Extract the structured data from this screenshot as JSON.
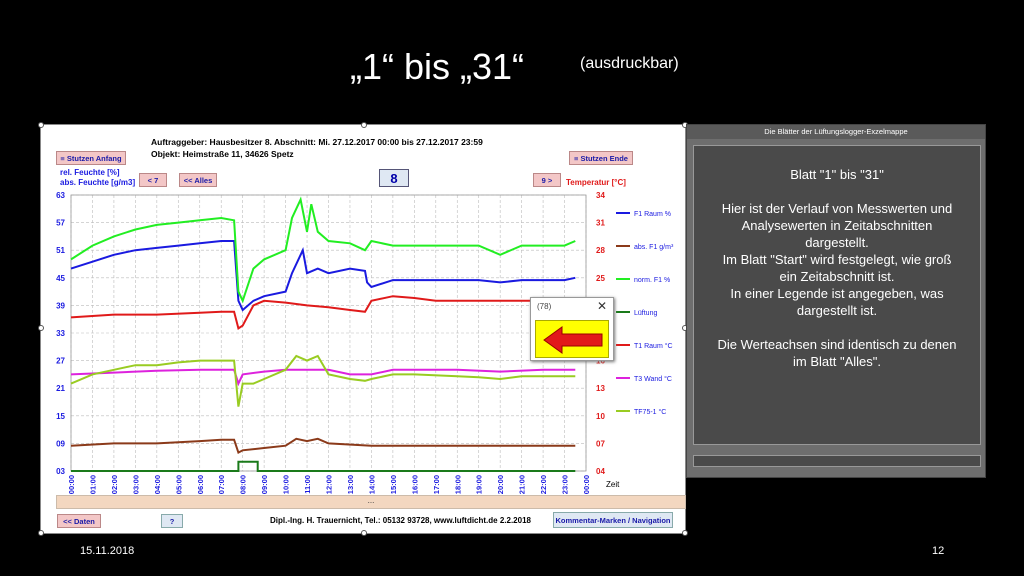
{
  "slide": {
    "title": "„1“ bis „31“",
    "subtitle": "(ausdruckbar)",
    "date": "15.11.2018",
    "page_number": "12"
  },
  "sheet": {
    "client_line": "Auftraggeber: Hausbesitzer     8. Abschnitt: Mi. 27.12.2017 00:00 bis 27.12.2017 23:59",
    "object_line": "Objekt: Heimstraße 11, 34626 Spetz",
    "btn_start": "≡ Stutzen Anfang",
    "btn_end": "≡ Stutzen Ende",
    "btn_prev": "< 7",
    "btn_all": "<< Alles",
    "btn_next": "9 >",
    "page_value": "8",
    "left_axis_label1": "rel. Feuchte [%]",
    "left_axis_label2": "abs. Feuchte [g/m3]",
    "right_axis_label": "Temperatur [°C]",
    "status_text": "...",
    "btn_data": "<< Daten",
    "btn_help": "?",
    "footer_text": "Dipl.-Ing. H. Trauernicht, Tel.: 05132 93728, www.luftdicht.de 2.2.2018",
    "btn_comment": "Kommentar-Marken / Navigation",
    "popup_title": "(78)",
    "popup_close": "✕"
  },
  "panel": {
    "title": "Die Blätter der Lüftungslogger-Exzelmappe",
    "lines": [
      "Blatt \"1\" bis \"31\"",
      "",
      "Hier ist der Verlauf von Messwerten und",
      "Analysewerten in Zeitabschnitten",
      "dargestellt.",
      "Im Blatt \"Start\" wird festgelegt, wie groß",
      "ein Zeitabschnitt ist.",
      "In einer Legende ist angegeben, was",
      "dargestellt ist.",
      "",
      "Die Werteachsen sind identisch zu denen",
      "im Blatt \"Alles\"."
    ]
  },
  "chart_data": {
    "type": "line",
    "x": [
      "00:00",
      "01:00",
      "02:00",
      "03:00",
      "04:00",
      "05:00",
      "06:00",
      "07:00",
      "08:00",
      "09:00",
      "10:00",
      "11:00",
      "12:00",
      "13:00",
      "14:00",
      "15:00",
      "16:00",
      "17:00",
      "18:00",
      "19:00",
      "20:00",
      "21:00",
      "22:00",
      "23:00",
      "00:00"
    ],
    "xlabel": "Zeit",
    "y_left_ticks": [
      "63",
      "57",
      "51",
      "45",
      "39",
      "33",
      "27",
      "21",
      "15",
      "09",
      "03"
    ],
    "y_left_range": [
      3,
      63
    ],
    "y_right_ticks": [
      "34",
      "31",
      "28",
      "25",
      "22",
      "19",
      "16",
      "13",
      "10",
      "07",
      "04"
    ],
    "y_right_range": [
      4,
      34
    ],
    "grid": true,
    "legend_position": "right",
    "series": [
      {
        "name": "F1 Raum %",
        "color": "#1a1ae0",
        "axis": "left",
        "x": [
          0,
          1,
          2,
          3,
          4,
          5,
          6,
          7,
          7.6,
          7.8,
          8,
          8.5,
          9,
          10,
          10.3,
          10.8,
          11,
          11.5,
          12,
          13,
          13.7,
          13.8,
          14,
          15,
          16,
          17,
          18,
          19,
          20,
          21,
          22,
          23,
          23.5
        ],
        "y": [
          47,
          48.5,
          50,
          51,
          51.5,
          52,
          52.5,
          53,
          53,
          40,
          38,
          40,
          41,
          42,
          46,
          51,
          46,
          47,
          46,
          47,
          46.5,
          44,
          43,
          44.5,
          44.5,
          44.5,
          44.5,
          44.5,
          44,
          44.5,
          44.5,
          44.5,
          45
        ]
      },
      {
        "name": "abs. F1 g/m³",
        "color": "#8b3a1a",
        "axis": "left",
        "x": [
          0,
          2,
          4,
          6,
          7,
          7.6,
          7.8,
          8,
          9,
          10,
          10.5,
          11,
          11.5,
          12,
          14,
          16,
          18,
          20,
          22,
          23.5
        ],
        "y": [
          8.5,
          9,
          9,
          9.5,
          9.8,
          9.8,
          7,
          7.5,
          8,
          8.5,
          10,
          9.5,
          10,
          9,
          8.5,
          8.5,
          8.5,
          8.5,
          8.5,
          8.5
        ]
      },
      {
        "name": "norm. F1 %",
        "color": "#22ee22",
        "axis": "left",
        "x": [
          0,
          1,
          2,
          3,
          4,
          5,
          6,
          7,
          7.6,
          7.8,
          8,
          8.5,
          9,
          10,
          10.3,
          10.7,
          11,
          11.2,
          11.5,
          12,
          13,
          13.7,
          14,
          15,
          16,
          17,
          18,
          19,
          20,
          21,
          22,
          23,
          23.5
        ],
        "y": [
          49,
          52,
          54,
          55.5,
          56.5,
          57,
          57.5,
          58,
          57.5,
          42,
          40,
          47,
          49,
          51,
          58,
          62,
          55,
          61,
          55,
          53,
          52.5,
          51,
          53,
          52,
          52,
          52,
          52,
          52,
          50,
          52,
          52,
          52,
          53
        ]
      },
      {
        "name": "Lüftung",
        "color": "#1a7a1a",
        "axis": "left",
        "x": [
          0,
          7.8,
          7.8,
          8.7,
          8.7,
          23.5
        ],
        "y": [
          3,
          3,
          5,
          5,
          3,
          3
        ]
      },
      {
        "name": "T1 Raum °C",
        "color": "#e01a1a",
        "axis": "right",
        "x": [
          0,
          2,
          4,
          6,
          7,
          7.6,
          7.8,
          8,
          8.5,
          9,
          10,
          11,
          12,
          13,
          13.7,
          14,
          15,
          16,
          17,
          18,
          19,
          20,
          21,
          22,
          23,
          23.5
        ],
        "y": [
          20.7,
          21,
          21,
          21.2,
          21.3,
          21.3,
          19.5,
          19.8,
          22,
          22.5,
          22.3,
          22,
          21.8,
          21.5,
          21.3,
          22.5,
          23,
          22.8,
          22.5,
          22.5,
          22.5,
          22.5,
          22.5,
          22.5,
          22.5,
          22.5
        ]
      },
      {
        "name": "T3 Wand °C",
        "color": "#dd22dd",
        "axis": "right",
        "x": [
          0,
          2,
          4,
          6,
          7,
          7.6,
          7.8,
          8,
          9,
          10,
          12,
          13,
          14,
          15,
          18,
          20,
          22,
          23.5
        ],
        "y": [
          14.5,
          14.7,
          14.9,
          15,
          15,
          15,
          13.5,
          14.5,
          14.8,
          15,
          15,
          14.5,
          14.5,
          15,
          15,
          14.8,
          15,
          15
        ]
      },
      {
        "name": "TF75-1 °C",
        "color": "#99cc22",
        "axis": "right",
        "x": [
          0,
          1,
          2,
          3,
          4,
          5,
          6,
          7,
          7.6,
          7.8,
          8,
          8.5,
          9,
          10,
          10.5,
          11,
          11.5,
          12,
          13,
          13.7,
          14,
          15,
          16,
          18,
          19,
          20,
          21,
          22,
          23,
          23.5
        ],
        "y": [
          13.5,
          14.5,
          15,
          15.5,
          15.5,
          15.8,
          16,
          16,
          16,
          11,
          13.5,
          13.5,
          14,
          15,
          16.5,
          16,
          16.5,
          14.5,
          14,
          13.8,
          14,
          14.5,
          14.5,
          14.3,
          14.2,
          14,
          14.3,
          14.3,
          14.3,
          14.3
        ]
      }
    ]
  }
}
